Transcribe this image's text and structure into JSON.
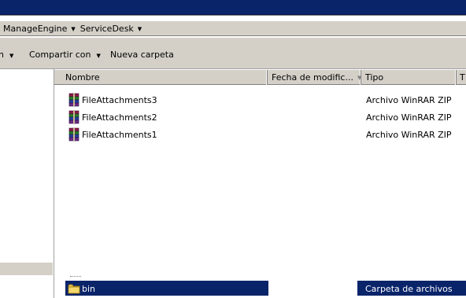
{
  "breadcrumb": [
    {
      "label": "ManageEngine"
    },
    {
      "label": "ServiceDesk"
    }
  ],
  "toolbar": {
    "organize_label": "n",
    "share_label": "Compartir con",
    "new_folder_label": "Nueva carpeta"
  },
  "columns": {
    "name": "Nombre",
    "date": "Fecha de modific...",
    "type": "Tipo",
    "size": "T"
  },
  "files": [
    {
      "name": "FileAttachments3",
      "type": "Archivo WinRAR ZIP",
      "icon": "winrar-archive-icon"
    },
    {
      "name": "FileAttachments2",
      "type": "Archivo WinRAR ZIP",
      "icon": "winrar-archive-icon"
    },
    {
      "name": "FileAttachments1",
      "type": "Archivo WinRAR ZIP",
      "icon": "winrar-archive-icon"
    }
  ],
  "selected": {
    "name": "bin",
    "type": "Carpeta de archivos",
    "icon": "folder-icon"
  },
  "colors": {
    "selection": "#0a246a",
    "chrome": "#d4d0c8"
  }
}
